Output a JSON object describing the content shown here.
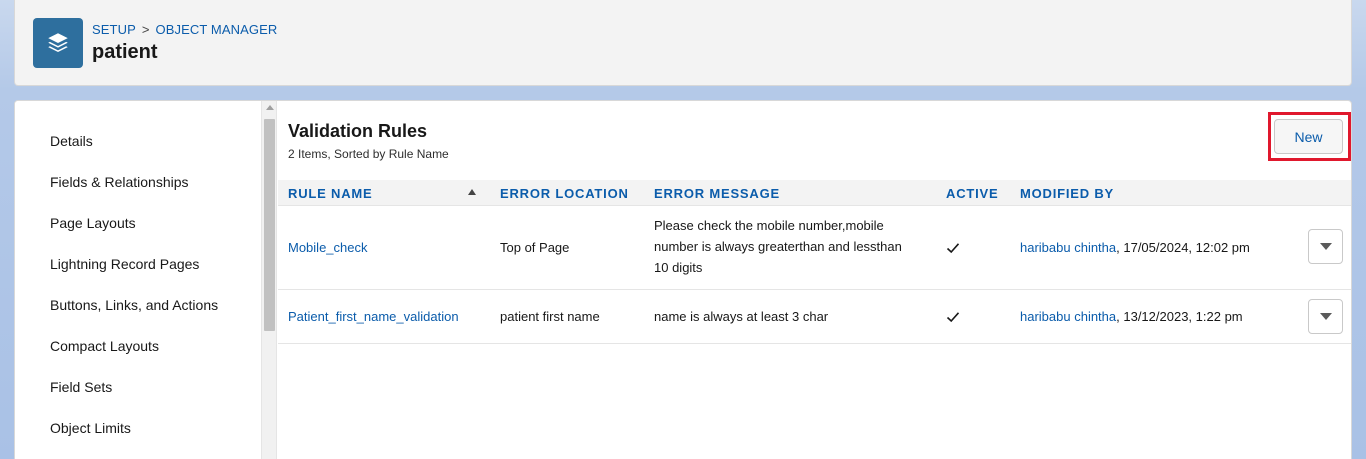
{
  "header": {
    "breadcrumb": [
      "SETUP",
      "OBJECT MANAGER"
    ],
    "breadcrumb_sep": ">",
    "title": "patient",
    "icon": "layers-icon"
  },
  "sidebar": {
    "items": [
      {
        "label": "Details"
      },
      {
        "label": "Fields & Relationships"
      },
      {
        "label": "Page Layouts"
      },
      {
        "label": "Lightning Record Pages"
      },
      {
        "label": "Buttons, Links, and Actions"
      },
      {
        "label": "Compact Layouts"
      },
      {
        "label": "Field Sets"
      },
      {
        "label": "Object Limits"
      }
    ]
  },
  "main": {
    "title": "Validation Rules",
    "subtitle": "2 Items, Sorted by Rule Name",
    "new_button": "New",
    "highlight_color": "#e0182d",
    "columns": [
      "RULE NAME",
      "ERROR LOCATION",
      "ERROR MESSAGE",
      "ACTIVE",
      "MODIFIED BY"
    ],
    "rows": [
      {
        "rule_name": "Mobile_check",
        "error_location": "Top of Page",
        "error_message_lines": [
          "Please check the mobile number,mobile",
          "number is always greaterthan and lessthan",
          "10 digits"
        ],
        "active": true,
        "modified_by_user": "haribabu chintha",
        "modified_by_date": ", 17/05/2024, 12:02 pm"
      },
      {
        "rule_name": "Patient_first_name_validation",
        "error_location": "patient first name",
        "error_message_lines": [
          "name is always at least 3 char"
        ],
        "active": true,
        "modified_by_user": "haribabu chintha",
        "modified_by_date": ", 13/12/2023, 1:22 pm"
      }
    ]
  },
  "colors": {
    "link": "#0b5cab",
    "icon_bg": "#2e6f9e"
  }
}
